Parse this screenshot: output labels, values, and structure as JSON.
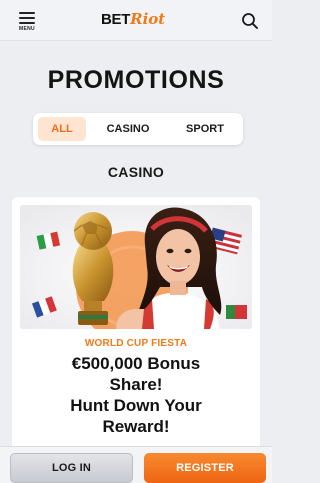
{
  "header": {
    "menu_label": "MENU",
    "logo_part1": "BET",
    "logo_part2": "Riot"
  },
  "page_title": "PROMOTIONS",
  "tabs": [
    {
      "label": "ALL",
      "active": true
    },
    {
      "label": "CASINO",
      "active": false
    },
    {
      "label": "SPORT",
      "active": false
    }
  ],
  "section_title": "CASINO",
  "promo": {
    "kicker": "WORLD CUP FIESTA",
    "headline": "€500,000 Bonus\nShare!\nHunt Down Your\nReward!"
  },
  "buttons": {
    "login": "LOG IN",
    "register": "REGISTER"
  },
  "colors": {
    "accent": "#f07a1a",
    "background": "#eceef2"
  }
}
